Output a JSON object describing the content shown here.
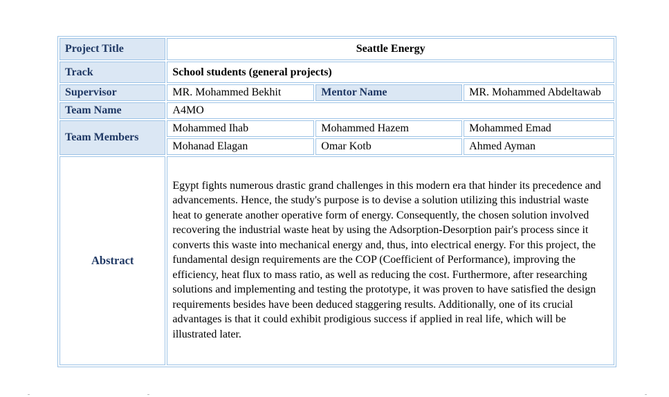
{
  "rows": {
    "project_title": {
      "label": "Project Title",
      "value": "Seattle Energy"
    },
    "track": {
      "label": "Track",
      "value": "School students (general projects)"
    },
    "supervisor": {
      "label": "Supervisor",
      "value": "MR. Mohammed Bekhit"
    },
    "mentor": {
      "label": "Mentor Name",
      "value": "MR. Mohammed Abdeltawab"
    },
    "team_name": {
      "label": "Team Name",
      "value": "A4MO"
    },
    "team_members": {
      "label": "Team Members",
      "members": [
        "Mohammed Ihab",
        "Mohammed Hazem",
        "Mohammed Emad",
        "Mohanad Elagan",
        "Omar Kotb",
        "Ahmed Ayman"
      ]
    },
    "abstract": {
      "label": "Abstract",
      "text": "Egypt fights numerous drastic grand challenges in this modern era that hinder its precedence and advancements. Hence, the study's purpose is to devise a solution utilizing this industrial waste heat to generate another operative form of energy. Consequently, the chosen solution involved recovering the industrial waste heat by using the Adsorption-Desorption pair's process since it converts this waste into mechanical energy and, thus, into electrical energy. For this project, the fundamental design requirements are the COP (Coefficient of Performance), improving the efficiency, heat flux to mass ratio, as well as reducing the cost. Furthermore, after researching solutions and implementing and testing the prototype, it was proven to have satisfied the design requirements besides have been deduced staggering results. Additionally, one of its crucial advantages is that it could exhibit prodigious success if applied in real life, which will be illustrated later."
    }
  },
  "colors": {
    "header_bg": "#dbe7f4",
    "header_text": "#1f3864",
    "border": "#9dc3e6"
  }
}
